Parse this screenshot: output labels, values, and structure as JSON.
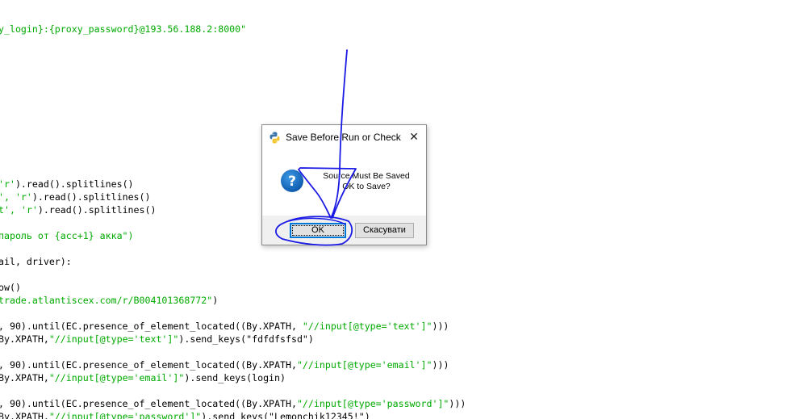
{
  "editor": {
    "lines": [
      {
        "pre": "y_login}:{proxy_password}@193.56.188.2:8000\"",
        "str": "",
        "post": ""
      },
      {
        "pre": "",
        "str": "'r'",
        "post": ").read().splitlines()"
      },
      {
        "pre": "', ",
        "str": "'r'",
        "post": ").read().splitlines()"
      },
      {
        "pre": "t', ",
        "str": "'r'",
        "post": ").read().splitlines()"
      },
      {
        "pre": "",
        "str": "пароль от {acc+1} акка\")",
        "post": ""
      },
      {
        "pre": "ail, driver):",
        "str": "",
        "post": ""
      },
      {
        "pre": "ow()",
        "str": "",
        "post": ""
      },
      {
        "pre": "",
        "str": "trade.atlantiscex.com/r/B004101368772\"",
        "post": ")"
      },
      {
        "pre": ", 90).until(EC.presence_of_element_located((By.XPATH, ",
        "str": "\"//input[@type='text']\"",
        "post": ")))"
      },
      {
        "pre": "By.XPATH,",
        "str": "\"//input[@type='text']\"",
        "post": ").send_keys(\"fdfdfsfsd\")"
      },
      {
        "pre": ", 90).until(EC.presence_of_element_located((By.XPATH,",
        "str": "\"//input[@type='email']\"",
        "post": ")))"
      },
      {
        "pre": "By.XPATH,",
        "str": "\"//input[@type='email']\"",
        "post": ").send_keys(login)"
      },
      {
        "pre": ", 90).until(EC.presence_of_element_located((By.XPATH,",
        "str": "\"//input[@type='password']\"",
        "post": ")))"
      },
      {
        "pre": "By.XPATH,",
        "str": "\"//input[@type='password']\"",
        "post": ").send_keys(\"Lemonchik12345!\")"
      }
    ]
  },
  "dialog": {
    "title": "Save Before Run or Check",
    "title_icon": "python-icon",
    "close_glyph": "✕",
    "message_line1": "Source Must Be Saved",
    "message_line2": "OK to Save?",
    "message_icon": "question-icon",
    "ok_label": "OK",
    "cancel_label": "Скасувати",
    "accent_color": "#0078d7",
    "annotation_color": "#1a1ae6"
  }
}
